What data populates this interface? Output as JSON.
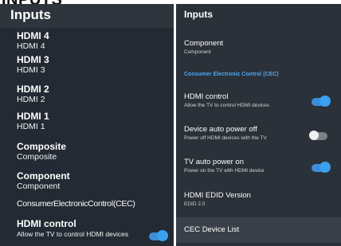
{
  "top_caption": "INPUTS",
  "left": {
    "title": "Inputs",
    "items": [
      {
        "name": "HDMI 4",
        "sub": "HDMI 4"
      },
      {
        "name": "HDMI 3",
        "sub": "HDMI 3"
      },
      {
        "name": "HDMI 2",
        "sub": "HDMI 2"
      },
      {
        "name": "HDMI 1",
        "sub": "HDMI 1"
      },
      {
        "name": "Composite",
        "sub": "Composite"
      },
      {
        "name": "Component",
        "sub": "Component"
      }
    ],
    "cec_label": "ConsumerElectronicControl(CEC)",
    "hdmi_control": {
      "name": "HDMI control",
      "desc": "Allow the TV to control HDMI devices",
      "state": "on"
    }
  },
  "right": {
    "title": "Inputs",
    "component": {
      "name": "Component",
      "sub": "Component"
    },
    "section_header": "Consumer Electronic Control (CEC)",
    "hdmi_control": {
      "name": "HDMI control",
      "desc": "Allow the TV to control HDMI devices",
      "state": "on"
    },
    "device_auto_power_off": {
      "name": "Device auto power off",
      "desc": "Power off HDMI devices with the TV",
      "state": "off"
    },
    "tv_auto_power_on": {
      "name": "TV auto power on",
      "desc": "Power on the TV with HDMI device",
      "state": "on"
    },
    "edid": {
      "name": "HDMI EDID Version",
      "value": "EDID 2.0"
    },
    "cec_device_list": "CEC Device List"
  },
  "colors": {
    "accent": "#3aa0f0",
    "panel_bg": "#232a33",
    "section_text": "#4aa6f2"
  }
}
